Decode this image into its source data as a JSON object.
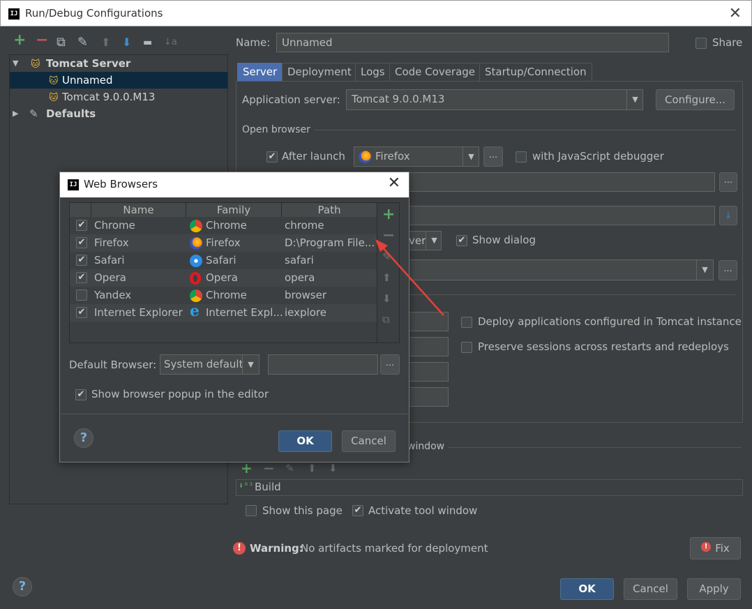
{
  "window": {
    "title": "Run/Debug Configurations",
    "logo": "IJ"
  },
  "toolbar": {
    "add": "+",
    "remove": "−",
    "copy": "⧉",
    "wrench": "✎",
    "up": "⬆",
    "down": "⬇",
    "folder": "▬",
    "sort": "↓a"
  },
  "tree": {
    "group": "Tomcat Server",
    "items": [
      "Unnamed",
      "Tomcat 9.0.0.M13"
    ],
    "defaults": "Defaults"
  },
  "config": {
    "name_label": "Name:",
    "name_value": "Unnamed",
    "share_label": "Share",
    "tabs": [
      "Server",
      "Deployment",
      "Logs",
      "Code Coverage",
      "Startup/Connection"
    ],
    "app_server_label": "Application server:",
    "app_server_value": "Tomcat 9.0.0.M13",
    "configure_label": "Configure...",
    "open_browser_label": "Open browser",
    "after_launch_label": "After launch",
    "browser_value": "Firefox",
    "js_debugger_label": "with JavaScript debugger",
    "show_dialog_label": "Show dialog",
    "deploy_label": "Deploy applications configured in Tomcat instance",
    "preserve_label": "Preserve sessions across restarts and redeploys",
    "window_label": "window",
    "build_label": "Build",
    "show_page_label": "Show this page",
    "activate_label": "Activate tool window",
    "warning_bold": "Warning:",
    "warning_text": "No artifacts marked for deployment",
    "fix_label": "Fix",
    "ok_label": "OK",
    "cancel_label": "Cancel",
    "apply_label": "Apply",
    "more": "..."
  },
  "dialog": {
    "title": "Web Browsers",
    "columns": [
      "Name",
      "Family",
      "Path"
    ],
    "rows": [
      {
        "checked": true,
        "name": "Chrome",
        "family": "Chrome",
        "family_icon": "chrome-icon",
        "path": "chrome"
      },
      {
        "checked": true,
        "name": "Firefox",
        "family": "Firefox",
        "family_icon": "firefox-icon",
        "path": "D:\\Program File..."
      },
      {
        "checked": true,
        "name": "Safari",
        "family": "Safari",
        "family_icon": "safari-icon",
        "path": "safari"
      },
      {
        "checked": true,
        "name": "Opera",
        "family": "Opera",
        "family_icon": "opera-icon",
        "path": "opera"
      },
      {
        "checked": false,
        "name": "Yandex",
        "family": "Chrome",
        "family_icon": "chrome-icon",
        "path": "browser"
      },
      {
        "checked": true,
        "name": "Internet Explorer",
        "family": "Internet Expl...",
        "family_icon": "ie-icon",
        "path": "iexplore"
      }
    ],
    "default_browser_label": "Default Browser:",
    "default_browser_value": "System default",
    "popup_label": "Show browser popup in the editor",
    "ok_label": "OK",
    "cancel_label": "Cancel",
    "more": "..."
  },
  "colors": {
    "accent": "#4b6eaf",
    "selection": "#0d293e",
    "add_green": "#59a869",
    "remove_red": "#c75450",
    "arrow_red": "#e8403a"
  }
}
